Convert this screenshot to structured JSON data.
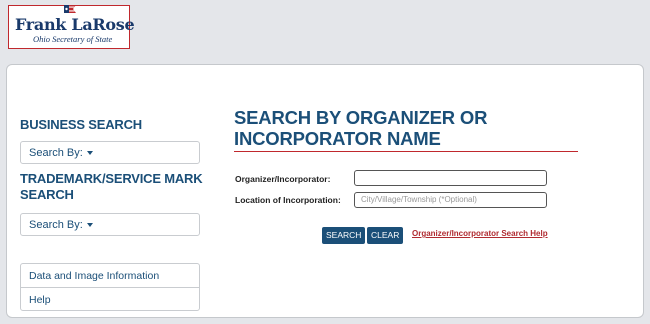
{
  "logo": {
    "name": "Frank LaRose",
    "subtitle": "Ohio Secretary of State"
  },
  "sidebar": {
    "business_heading": "BUSINESS SEARCH",
    "business_dropdown": "Search By:",
    "trademark_heading": "TRADEMARK/SERVICE MARK SEARCH",
    "trademark_dropdown": "Search By:",
    "links": [
      "Data and Image Information",
      "Help"
    ]
  },
  "main": {
    "title": "SEARCH BY ORGANIZER OR INCORPORATOR NAME",
    "organizer_label": "Organizer/Incorporator:",
    "organizer_value": "",
    "location_label": "Location of Incorporation:",
    "location_placeholder": "City/Village/Township (*Optional)",
    "search_button": "SEARCH",
    "clear_button": "CLEAR",
    "help_link": "Organizer/Incorporator Search Help"
  },
  "colors": {
    "brand_blue": "#1b4f78",
    "accent_red": "#c0282d",
    "background": "#e4e6ea"
  }
}
